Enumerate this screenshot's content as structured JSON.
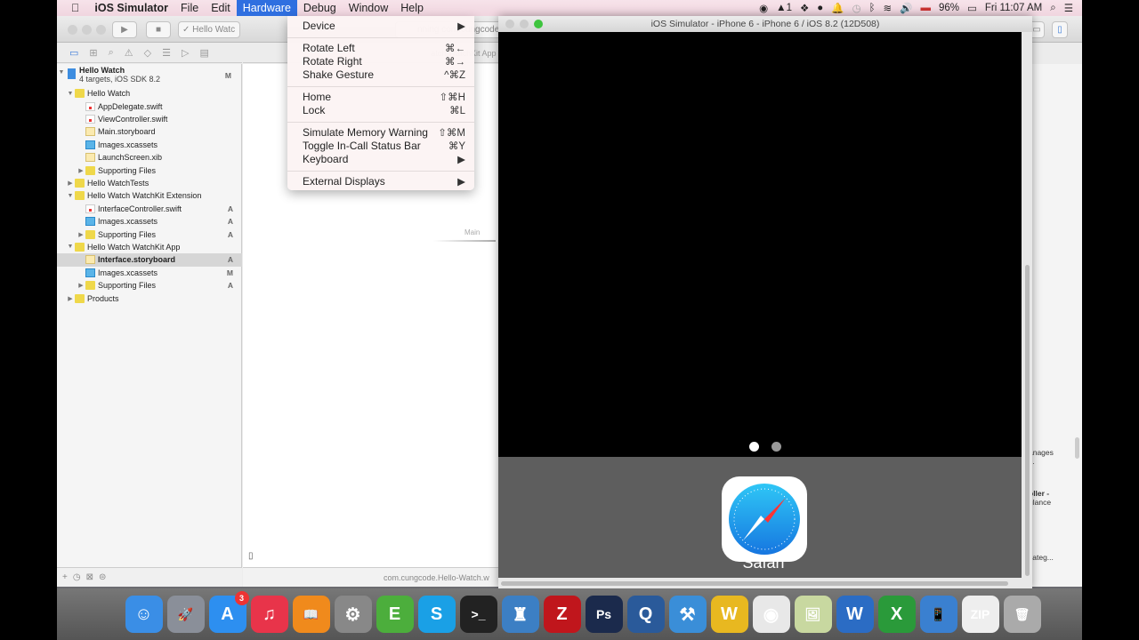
{
  "menubar": {
    "app": "iOS Simulator",
    "items": [
      "File",
      "Edit",
      "Hardware",
      "Debug",
      "Window",
      "Help"
    ],
    "active": "Hardware",
    "status": {
      "adobe_count": "1",
      "battery": "96%",
      "clock": "Fri 11:07 AM"
    }
  },
  "hardware_menu": {
    "items": [
      {
        "label": "Device",
        "shortcut": "▶"
      },
      {
        "label": "Rotate Left",
        "shortcut": "⌘←"
      },
      {
        "label": "Rotate Right",
        "shortcut": "⌘→"
      },
      {
        "label": "Shake Gesture",
        "shortcut": "^⌘Z"
      },
      {
        "label": "Home",
        "shortcut": "⇧⌘H"
      },
      {
        "label": "Lock",
        "shortcut": "⌘L"
      },
      {
        "label": "Simulate Memory Warning",
        "shortcut": "⇧⌘M"
      },
      {
        "label": "Toggle In-Call Status Bar",
        "shortcut": "⌘Y"
      },
      {
        "label": "Keyboard",
        "shortcut": "▶"
      },
      {
        "label": "External Displays",
        "shortcut": "▶"
      }
    ]
  },
  "xcode": {
    "scheme": "Hello Watc",
    "activity": "nning com.cungcode",
    "jumpbar": "atch WatchKit App",
    "footer_path": "com.cungcode.Hello-Watch.w",
    "project": {
      "name": "Hello Watch",
      "subtitle": "4 targets, iOS SDK 8.2",
      "badge": "M"
    },
    "tree": [
      {
        "label": "Hello Watch",
        "type": "folder",
        "level": 1,
        "disc": "▼",
        "badge": ""
      },
      {
        "label": "AppDelegate.swift",
        "type": "swift",
        "level": 2,
        "disc": "",
        "badge": ""
      },
      {
        "label": "ViewController.swift",
        "type": "swift",
        "level": 2,
        "disc": "",
        "badge": ""
      },
      {
        "label": "Main.storyboard",
        "type": "sb",
        "level": 2,
        "disc": "",
        "badge": ""
      },
      {
        "label": "Images.xcassets",
        "type": "xc",
        "level": 2,
        "disc": "",
        "badge": ""
      },
      {
        "label": "LaunchScreen.xib",
        "type": "sb",
        "level": 2,
        "disc": "",
        "badge": ""
      },
      {
        "label": "Supporting Files",
        "type": "folder",
        "level": 2,
        "disc": "▶",
        "badge": ""
      },
      {
        "label": "Hello WatchTests",
        "type": "folder",
        "level": 1,
        "disc": "▶",
        "badge": ""
      },
      {
        "label": "Hello Watch WatchKit Extension",
        "type": "folder",
        "level": 1,
        "disc": "▼",
        "badge": ""
      },
      {
        "label": "InterfaceController.swift",
        "type": "swift",
        "level": 2,
        "disc": "",
        "badge": "A"
      },
      {
        "label": "Images.xcassets",
        "type": "xc",
        "level": 2,
        "disc": "",
        "badge": "A"
      },
      {
        "label": "Supporting Files",
        "type": "folder",
        "level": 2,
        "disc": "▶",
        "badge": "A"
      },
      {
        "label": "Hello Watch WatchKit App",
        "type": "folder",
        "level": 1,
        "disc": "▼",
        "badge": ""
      },
      {
        "label": "Interface.storyboard",
        "type": "sb",
        "level": 2,
        "disc": "",
        "badge": "A",
        "selected": true
      },
      {
        "label": "Images.xcassets",
        "type": "xc",
        "level": 2,
        "disc": "",
        "badge": "M"
      },
      {
        "label": "Supporting Files",
        "type": "folder",
        "level": 2,
        "disc": "▶",
        "badge": "A"
      },
      {
        "label": "Products",
        "type": "folder",
        "level": 1,
        "disc": "▶",
        "badge": ""
      }
    ],
    "canvas_entry_label": "Main",
    "library_snippets": [
      "anages",
      "s.",
      "oller -",
      "glance",
      "categ..."
    ]
  },
  "simulator": {
    "title": "iOS Simulator - iPhone 6 - iPhone 6 / iOS 8.2 (12D508)",
    "app_label": "Safari",
    "pages": 2,
    "current_page": 1
  },
  "dock": {
    "apps": [
      {
        "name": "finder",
        "bg": "#3a8ee6",
        "glyph": "☺"
      },
      {
        "name": "launchpad",
        "bg": "#8a8f99",
        "glyph": "🚀"
      },
      {
        "name": "app-store",
        "bg": "#2d8ff0",
        "glyph": "A",
        "badge": "3"
      },
      {
        "name": "itunes",
        "bg": "#e8344a",
        "glyph": "♫"
      },
      {
        "name": "ibooks",
        "bg": "#f08a1c",
        "glyph": "📖"
      },
      {
        "name": "system-preferences",
        "bg": "#888",
        "glyph": "⚙"
      },
      {
        "name": "evernote",
        "bg": "#4cae3c",
        "glyph": "E"
      },
      {
        "name": "skype",
        "bg": "#1aa0e6",
        "glyph": "S"
      },
      {
        "name": "terminal",
        "bg": "#222",
        "glyph": ">_"
      },
      {
        "name": "sequel-pro",
        "bg": "#3c7fc4",
        "glyph": "♜"
      },
      {
        "name": "filezilla",
        "bg": "#c0161c",
        "glyph": "Z"
      },
      {
        "name": "photoshop",
        "bg": "#1b2a4c",
        "glyph": "Ps"
      },
      {
        "name": "quicktime",
        "bg": "#2a5a9a",
        "glyph": "Q"
      },
      {
        "name": "xcode",
        "bg": "#3a8ed8",
        "glyph": "⚒"
      },
      {
        "name": "wireshark",
        "bg": "#e8b820",
        "glyph": "W"
      },
      {
        "name": "chrome",
        "bg": "#e8e8e8",
        "glyph": "◉"
      },
      {
        "name": "preview",
        "bg": "#c8d8a0",
        "glyph": "🖼"
      },
      {
        "name": "word",
        "bg": "#2b6cc4",
        "glyph": "W"
      },
      {
        "name": "excel",
        "bg": "#2a9a3a",
        "glyph": "X"
      },
      {
        "name": "ios-simulator",
        "bg": "#3a80d0",
        "glyph": "📱"
      },
      {
        "name": "archive",
        "bg": "#eee",
        "glyph": "ZIP"
      },
      {
        "name": "trash",
        "bg": "#aaa",
        "glyph": "🗑"
      }
    ]
  }
}
